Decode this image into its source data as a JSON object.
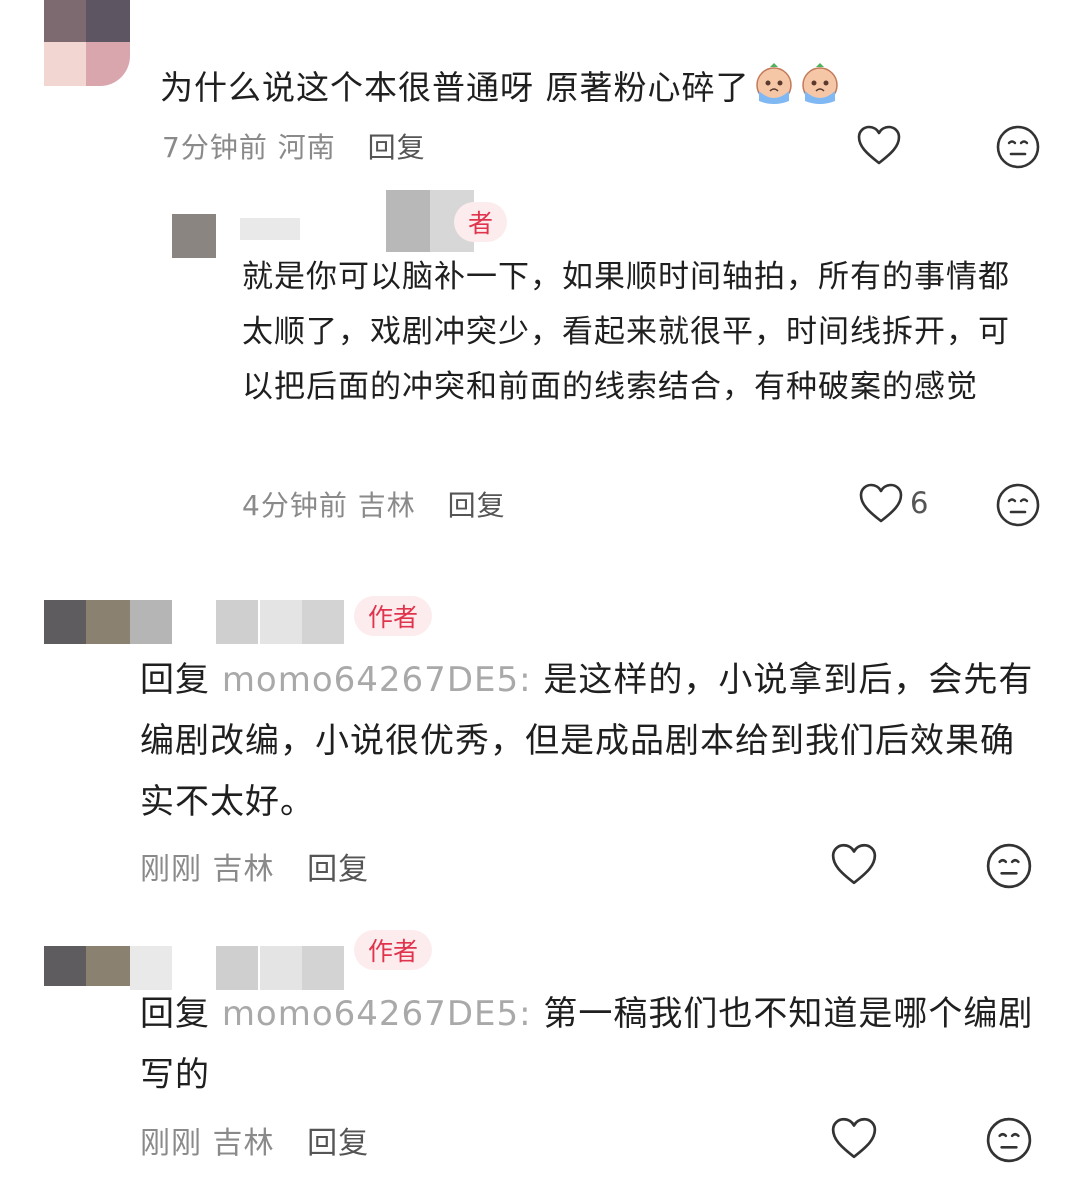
{
  "comments": [
    {
      "text": "为什么说这个本很普通呀 原著粉心碎了",
      "emoji": [
        "crying-face-icon",
        "crying-face-icon"
      ],
      "time": "7分钟前",
      "location": "河南",
      "reply_label": "回复",
      "reply": {
        "badge": "者",
        "text": "就是你可以脑补一下，如果顺时间轴拍，所有的事情都太顺了，戏剧冲突少，看起来就很平，时间线拆开，可以把后面的冲突和前面的线索结合，有种破案的感觉",
        "time": "4分钟前",
        "location": "吉林",
        "reply_label": "回复",
        "like_count": "6"
      }
    },
    {
      "badge": "作者",
      "prefix": "回复",
      "mention": "momo64267DE5:",
      "text": "是这样的，小说拿到后，会先有编剧改编，小说很优秀，但是成品剧本给到我们后效果确实不太好。",
      "time": "刚刚",
      "location": "吉林",
      "reply_label": "回复"
    },
    {
      "badge": "作者",
      "prefix": "回复",
      "mention": "momo64267DE5:",
      "text": "第一稿我们也不知道是哪个编剧写的",
      "time": "刚刚",
      "location": "吉林",
      "reply_label": "回复"
    }
  ],
  "icons": {
    "like": "heart-outline-icon",
    "dislike": "meh-face-icon"
  },
  "colors": {
    "badge_text": "#e0344d",
    "badge_bg": "#fdecee",
    "meta_text": "#8a8a8a",
    "mention_text": "#a9a9a9"
  }
}
